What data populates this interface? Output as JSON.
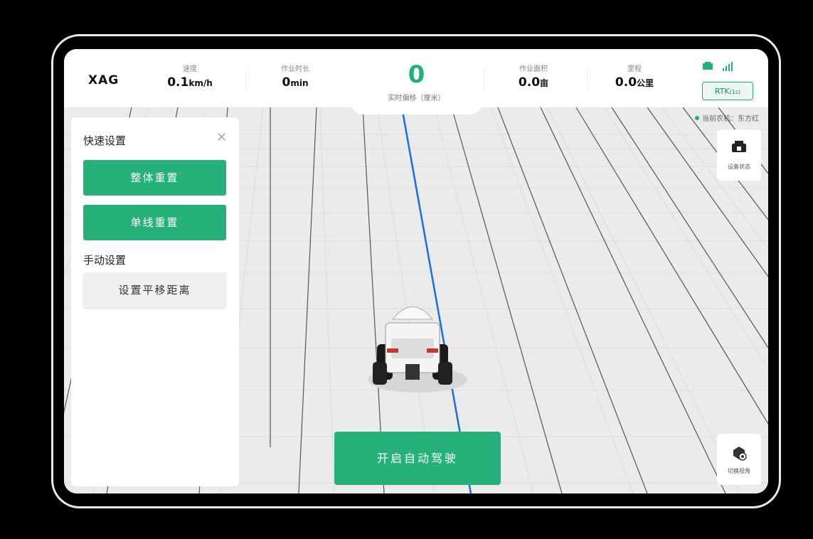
{
  "brand": {
    "logo": "XAG"
  },
  "stats": {
    "speed": {
      "label": "速度",
      "value": "0.1",
      "unit": "km/h"
    },
    "duration": {
      "label": "作业时长",
      "value": "0",
      "unit": "min"
    },
    "offset": {
      "value": "0",
      "label": "实时偏移（厘米）"
    },
    "area": {
      "label": "作业面积",
      "value": "0.0",
      "unit": "亩"
    },
    "mileage": {
      "label": "里程",
      "value": "0.0",
      "unit": "公里"
    }
  },
  "rtk": {
    "label": "RTK",
    "age": "(1s)"
  },
  "farm_machine": "当前农机：东方红",
  "quick_panel": {
    "title": "快速设置",
    "reset_all": "整体重置",
    "reset_line": "单线重置",
    "manual_title": "手动设置",
    "set_shift": "设置平移距离"
  },
  "device_status": "设备状态",
  "switch_view": "切换视角",
  "start_autopilot": "开启自动驾驶",
  "colors": {
    "accent": "#26b07a",
    "guide_line": "#1a6fe0"
  },
  "icons": [
    "close-icon",
    "tractor-icon",
    "signal-icon",
    "device-status-icon",
    "switch-view-icon"
  ]
}
